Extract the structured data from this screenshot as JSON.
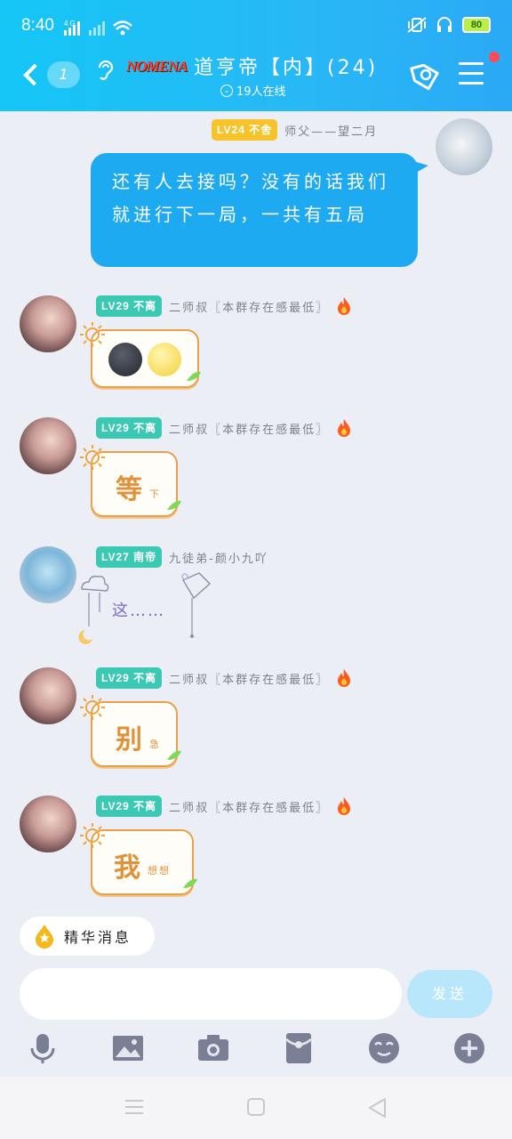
{
  "status_bar": {
    "time": "8:40",
    "network": "4G",
    "battery": "80"
  },
  "header": {
    "unread_count": "1",
    "logo_text": "NOMENA",
    "group_title": "道亨帝【内】(24)",
    "online_text": "19人在线"
  },
  "messages": [
    {
      "sender": "me",
      "level": "LV24",
      "title": "不舍",
      "nickname": "师父——望二月",
      "text": "还有人去接吗？没有的话我们就进行下一局，一共有五局"
    },
    {
      "sender": "other",
      "level": "LV29",
      "title": "不离",
      "nickname": "二师叔〖本群存在感最低〗",
      "content": "moon-sun-emoji"
    },
    {
      "sender": "other",
      "level": "LV29",
      "title": "不离",
      "nickname": "二师叔〖本群存在感最低〗",
      "big": "等",
      "small": "下"
    },
    {
      "sender": "other",
      "level": "LV27",
      "title": "南帝",
      "nickname": "九徒弟-颜小九吖",
      "sticker_text": "这……"
    },
    {
      "sender": "other",
      "level": "LV29",
      "title": "不离",
      "nickname": "二师叔〖本群存在感最低〗",
      "big": "别",
      "small": "急"
    },
    {
      "sender": "other",
      "level": "LV29",
      "title": "不离",
      "nickname": "二师叔〖本群存在感最低〗",
      "big": "我",
      "small": "想想"
    }
  ],
  "essence_label": "精华消息",
  "input": {
    "placeholder": "",
    "send_label": "发送"
  },
  "toolbar": [
    "mic-icon",
    "image-icon",
    "camera-icon",
    "red-packet-icon",
    "emoji-icon",
    "plus-icon"
  ],
  "colors": {
    "header": "#14c6f5",
    "my_bubble": "#1eaaf0",
    "level_teal": "#3cc9b4",
    "level_yellow": "#f6c32a"
  }
}
